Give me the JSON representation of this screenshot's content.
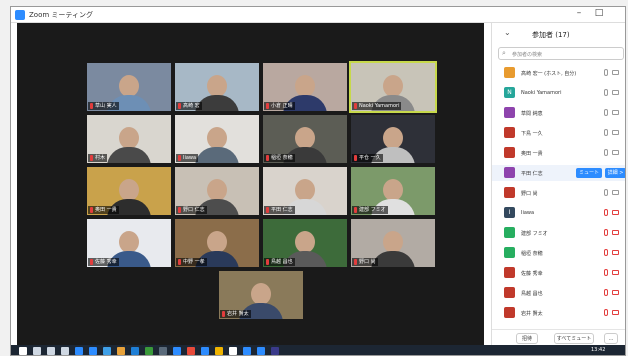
{
  "window": {
    "title": "Zoom ミーティング",
    "min": "–",
    "max": "□"
  },
  "participants_panel": {
    "title": "参加者 (17)",
    "search_placeholder": "参加者の検索",
    "mute_button": "ミュート",
    "more_button": "詳細 >",
    "mute_all": "すべてミュート",
    "invite": "招待",
    "list": [
      {
        "initial": "",
        "name": "高崎 宏一 (ホスト, 自分)",
        "color": "#e89b2f",
        "mic_muted": false,
        "cam_off": false
      },
      {
        "initial": "N",
        "name": "Naoki Yamamori",
        "color": "#26a69a",
        "mic_muted": false,
        "cam_off": false
      },
      {
        "initial": "",
        "name": "草間 純恵",
        "color": "#8e44ad",
        "mic_muted": false,
        "cam_off": false
      },
      {
        "initial": "",
        "name": "下鳥 一久",
        "color": "#c0392b",
        "mic_muted": false,
        "cam_off": false
      },
      {
        "initial": "",
        "name": "奥田 一貴",
        "color": "#c0392b",
        "mic_muted": false,
        "cam_off": false
      },
      {
        "initial": "",
        "name": "平田 仁志",
        "color": "#8e44ad",
        "mic_muted": false,
        "cam_off": false
      },
      {
        "initial": "",
        "name": "野口 尚",
        "color": "#c0392b",
        "mic_muted": false,
        "cam_off": false
      },
      {
        "initial": "I",
        "name": "Iiawa",
        "color": "#34495e",
        "mic_muted": true,
        "cam_off": true
      },
      {
        "initial": "",
        "name": "建部 フミオ",
        "color": "#27ae60",
        "mic_muted": true,
        "cam_off": true
      },
      {
        "initial": "",
        "name": "稲垣 奈穂",
        "color": "#27ae60",
        "mic_muted": true,
        "cam_off": true
      },
      {
        "initial": "",
        "name": "佐藤 秀幸",
        "color": "#c0392b",
        "mic_muted": true,
        "cam_off": true
      },
      {
        "initial": "",
        "name": "鳥越 昌也",
        "color": "#c0392b",
        "mic_muted": true,
        "cam_off": true
      },
      {
        "initial": "",
        "name": "岩井 賢太",
        "color": "#c0392b",
        "mic_muted": true,
        "cam_off": true
      }
    ]
  },
  "tiles": [
    {
      "name": "草山 実人",
      "bg": "#7b8aa0",
      "shirt": "#6d8fb5"
    },
    {
      "name": "高崎 宏",
      "bg": "#a7b8c6",
      "shirt": "#3c3c3c"
    },
    {
      "name": "小倉 正晴",
      "bg": "#b9a8a0",
      "shirt": "#2d3a6a"
    },
    {
      "name": "Naoki Yamamori",
      "bg": "#c8c4b8",
      "shirt": "#8a8a8a"
    },
    {
      "name": "村木",
      "bg": "#d9d6cf",
      "shirt": "#4a4a4a"
    },
    {
      "name": "Iiawa",
      "bg": "#e2e0dc",
      "shirt": "#5a6a7a"
    },
    {
      "name": "稲垣 奈穂",
      "bg": "#5c5d55",
      "shirt": "#3a3a3a"
    },
    {
      "name": "平仓 一久",
      "bg": "#2e3038",
      "shirt": "#bfbfbf"
    },
    {
      "name": "奥田 一貴",
      "bg": "#c9a24b",
      "shirt": "#2d2d2d"
    },
    {
      "name": "野口 仁志",
      "bg": "#c8c0b5",
      "shirt": "#4d4d4d"
    },
    {
      "name": "平田 仁志",
      "bg": "#d9d3cc",
      "shirt": "#d7d7d7"
    },
    {
      "name": "建部 フミオ",
      "bg": "#7c9a6a",
      "shirt": "#e0e0e0"
    },
    {
      "name": "佐藤 秀幸",
      "bg": "#e8eaee",
      "shirt": "#3a5a8a"
    },
    {
      "name": "中野 一孝",
      "bg": "#8b6d4a",
      "shirt": "#2a3a5a"
    },
    {
      "name": "鳥越 昌也",
      "bg": "#3d6b3a",
      "shirt": "#5a5a5a"
    },
    {
      "name": "野口 尚",
      "bg": "#b2aba4",
      "shirt": "#3a3a3a"
    },
    {
      "name": "岩井 賢太",
      "bg": "#8a7a5a",
      "shirt": "#3a4a6a"
    }
  ],
  "taskbar": {
    "time": "13:42"
  }
}
